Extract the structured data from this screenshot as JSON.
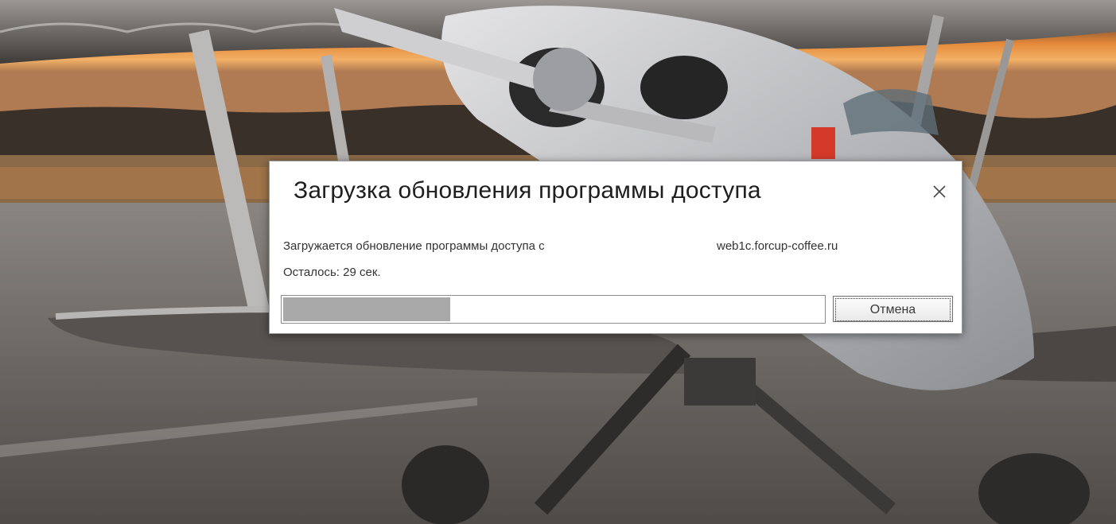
{
  "dialog": {
    "title": "Загрузка обновления программы доступа",
    "message_prefix": "Загружается обновление программы доступа с",
    "host": "web1c.forcup-coffee.ru",
    "remaining": "Осталось: 29 сек.",
    "progress_fraction": 0.31,
    "cancel_label": "Отмена",
    "close_icon": "close-icon"
  },
  "background": {
    "description_icon": "biplane-wallpaper",
    "colors": {
      "sky_top": "#3a2e28",
      "sunset": "#e88a3c",
      "tarmac": "#6e6a66"
    }
  }
}
